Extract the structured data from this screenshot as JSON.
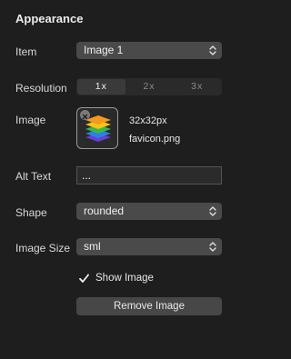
{
  "panel": {
    "title": "Appearance"
  },
  "item": {
    "label": "Item",
    "value": "Image 1"
  },
  "resolution": {
    "label": "Resolution",
    "options": [
      "1x",
      "2x",
      "3x"
    ],
    "selected": "1x"
  },
  "image": {
    "label": "Image",
    "size": "32x32px",
    "filename": "favicon.png",
    "icon": "stacked-layers-icon"
  },
  "alt_text": {
    "label": "Alt Text",
    "value": "..."
  },
  "shape": {
    "label": "Shape",
    "value": "rounded"
  },
  "image_size": {
    "label": "Image Size",
    "value": "sml"
  },
  "show_image": {
    "label": "Show Image",
    "checked": true
  },
  "remove_button": {
    "label": "Remove Image"
  },
  "colors": {
    "background": "#1e1e1e",
    "control": "#4a4a4a",
    "segment_active": "#3a3a3a"
  }
}
